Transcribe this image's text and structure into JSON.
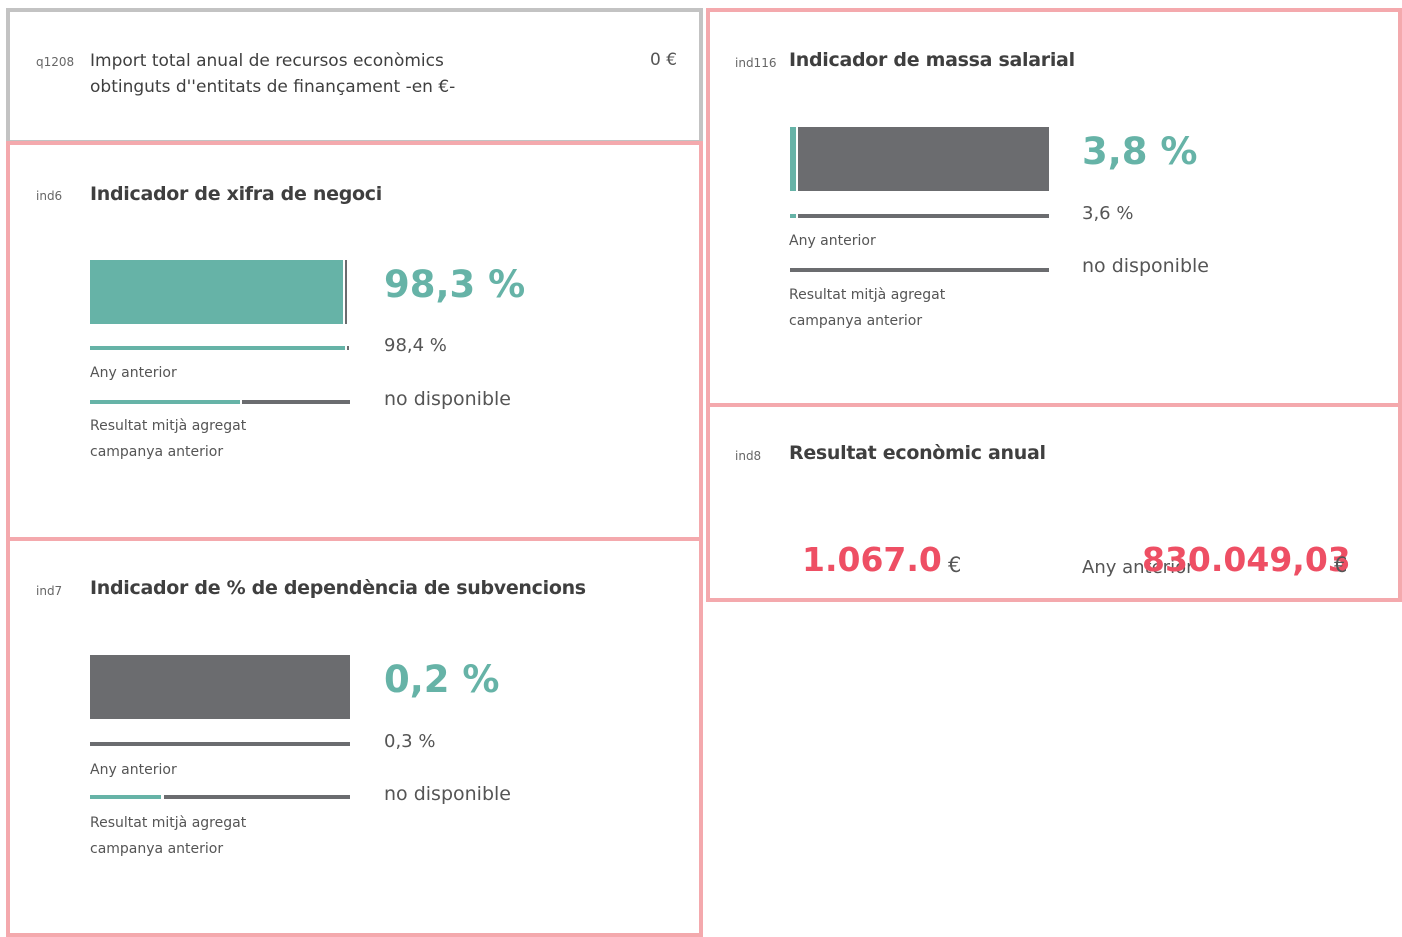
{
  "q1208": {
    "code": "q1208",
    "question": "Import total anual de recursos econòmics obtinguts d''entitats de finançament -en €-",
    "value": "0 €"
  },
  "ind6": {
    "code": "ind6",
    "title": "Indicador de xifra de negoci",
    "value": "98,3 %",
    "previous": "98,4 %",
    "aggregate": "no disponible",
    "label_previous": "Any anterior",
    "label_aggregate_1": "Resultat mitjà agregat",
    "label_aggregate_2": "campanya anterior",
    "current_fraction": 0.983,
    "previous_fraction": 0.984
  },
  "ind7": {
    "code": "ind7",
    "title": "Indicador de % de dependència de subvencions",
    "value": "0,2 %",
    "previous": "0,3 %",
    "aggregate": "no disponible",
    "label_previous": "Any anterior",
    "label_aggregate_1": "Resultat mitjà agregat",
    "label_aggregate_2": "campanya anterior",
    "current_fraction": 0.002,
    "previous_fraction": 0.003
  },
  "ind116": {
    "code": "ind116",
    "title": "Indicador de massa salarial",
    "value": "3,8 %",
    "previous": "3,6 %",
    "aggregate": "no disponible",
    "label_previous": "Any anterior",
    "label_aggregate_1": "Resultat mitjà agregat",
    "label_aggregate_2": "campanya anterior",
    "current_fraction": 0.038,
    "previous_fraction": 0.036
  },
  "ind8": {
    "code": "ind8",
    "title": "Resultat econòmic anual",
    "value": "1.067.0",
    "currency": "€",
    "label_previous": "Any anterior",
    "previous": "830.049,03",
    "previous_currency": "€"
  },
  "colors": {
    "teal": "#66b3a7",
    "dark": "#6b6c6f",
    "red": "#ee4f64",
    "card_border_pink": "#f4a9ad",
    "card_border_grey": "#c3c3c3"
  }
}
